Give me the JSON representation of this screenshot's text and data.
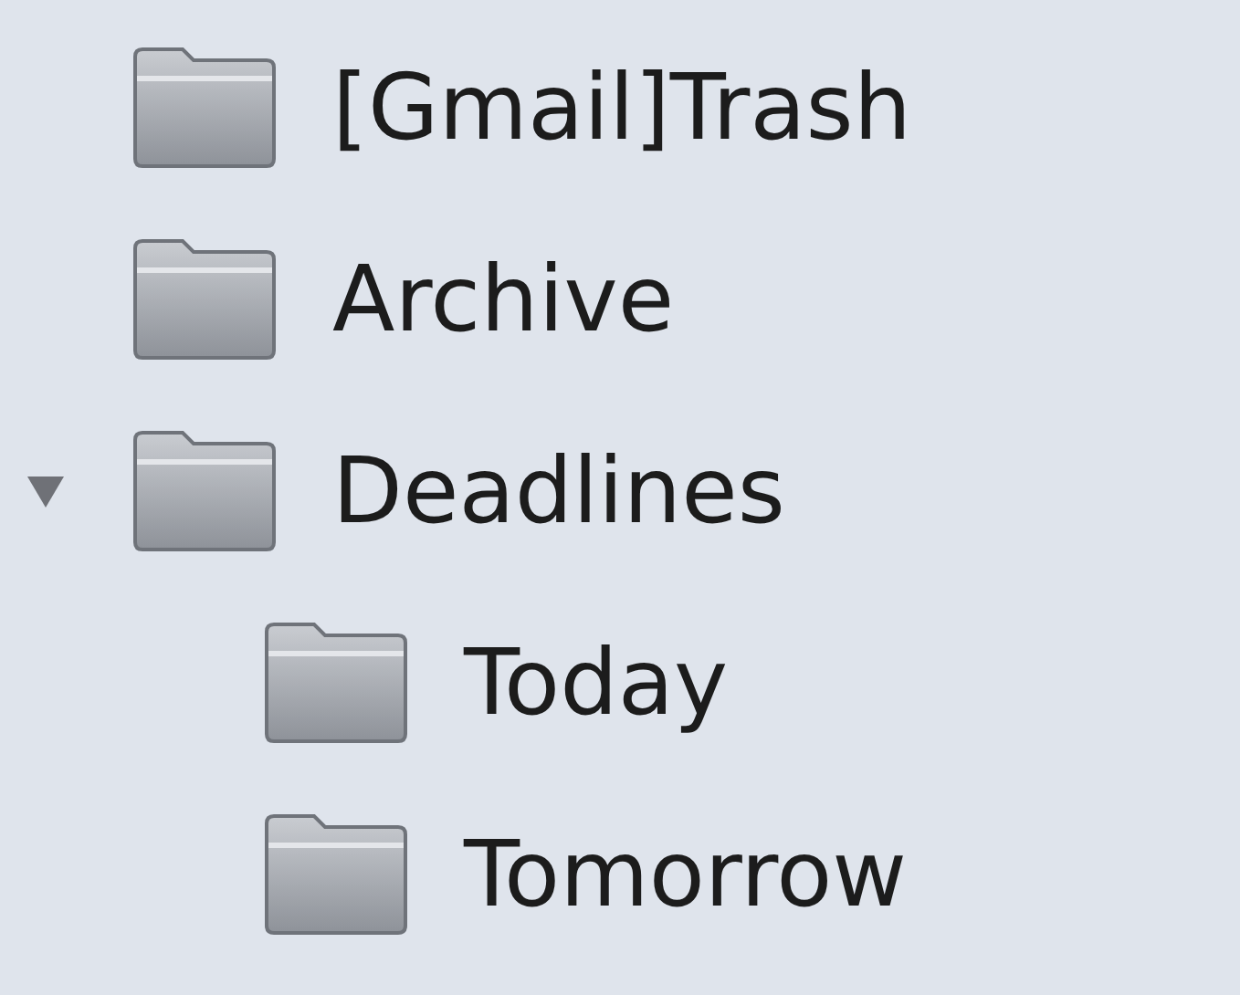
{
  "folders": [
    {
      "label": "[Gmail]Trash"
    },
    {
      "label": "Archive"
    },
    {
      "label": "Deadlines",
      "expanded": true,
      "children": [
        {
          "label": "Today"
        },
        {
          "label": "Tomorrow"
        }
      ]
    }
  ]
}
